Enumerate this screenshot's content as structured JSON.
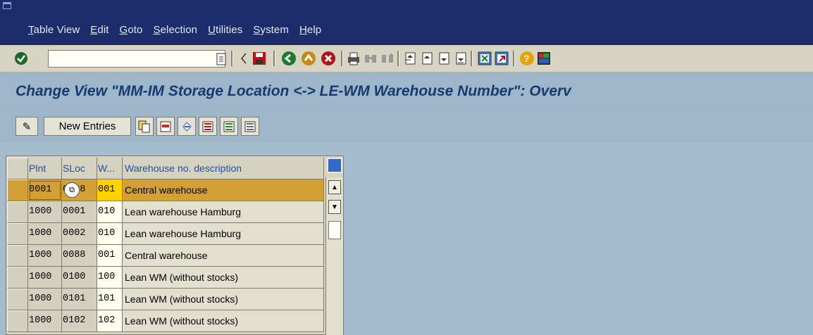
{
  "menu": [
    "Table View",
    "Edit",
    "Goto",
    "Selection",
    "Utilities",
    "System",
    "Help"
  ],
  "toolbar": {
    "command_value": "",
    "icons": [
      "enter-icon",
      "history-icon",
      "back-icon",
      "save-icon",
      "back-nav-icon",
      "exit-icon",
      "cancel-icon",
      "print-icon",
      "find-icon",
      "find-next-icon",
      "first-page-icon",
      "prev-page-icon",
      "next-page-icon",
      "last-page-icon",
      "create-session-icon",
      "shortcut-icon",
      "help-icon",
      "customize-icon"
    ]
  },
  "page": {
    "title": "Change View \"MM-IM Storage Location <-> LE-WM Warehouse Number\": Overv"
  },
  "app_toolbar": {
    "new_entries_label": "New Entries"
  },
  "table": {
    "headers": {
      "plnt": "Plnt",
      "sloc": "SLoc",
      "w": "W...",
      "desc": "Warehouse no. description"
    },
    "rows": [
      {
        "plnt": "0001",
        "sloc": "0088",
        "w": "001",
        "desc": "Central warehouse"
      },
      {
        "plnt": "1000",
        "sloc": "0001",
        "w": "010",
        "desc": "Lean warehouse Hamburg"
      },
      {
        "plnt": "1000",
        "sloc": "0002",
        "w": "010",
        "desc": "Lean warehouse Hamburg"
      },
      {
        "plnt": "1000",
        "sloc": "0088",
        "w": "001",
        "desc": "Central warehouse"
      },
      {
        "plnt": "1000",
        "sloc": "0100",
        "w": "100",
        "desc": "Lean WM (without stocks)"
      },
      {
        "plnt": "1000",
        "sloc": "0101",
        "w": "101",
        "desc": "Lean WM (without stocks)"
      },
      {
        "plnt": "1000",
        "sloc": "0102",
        "w": "102",
        "desc": "Lean WM (without stocks)"
      }
    ]
  }
}
